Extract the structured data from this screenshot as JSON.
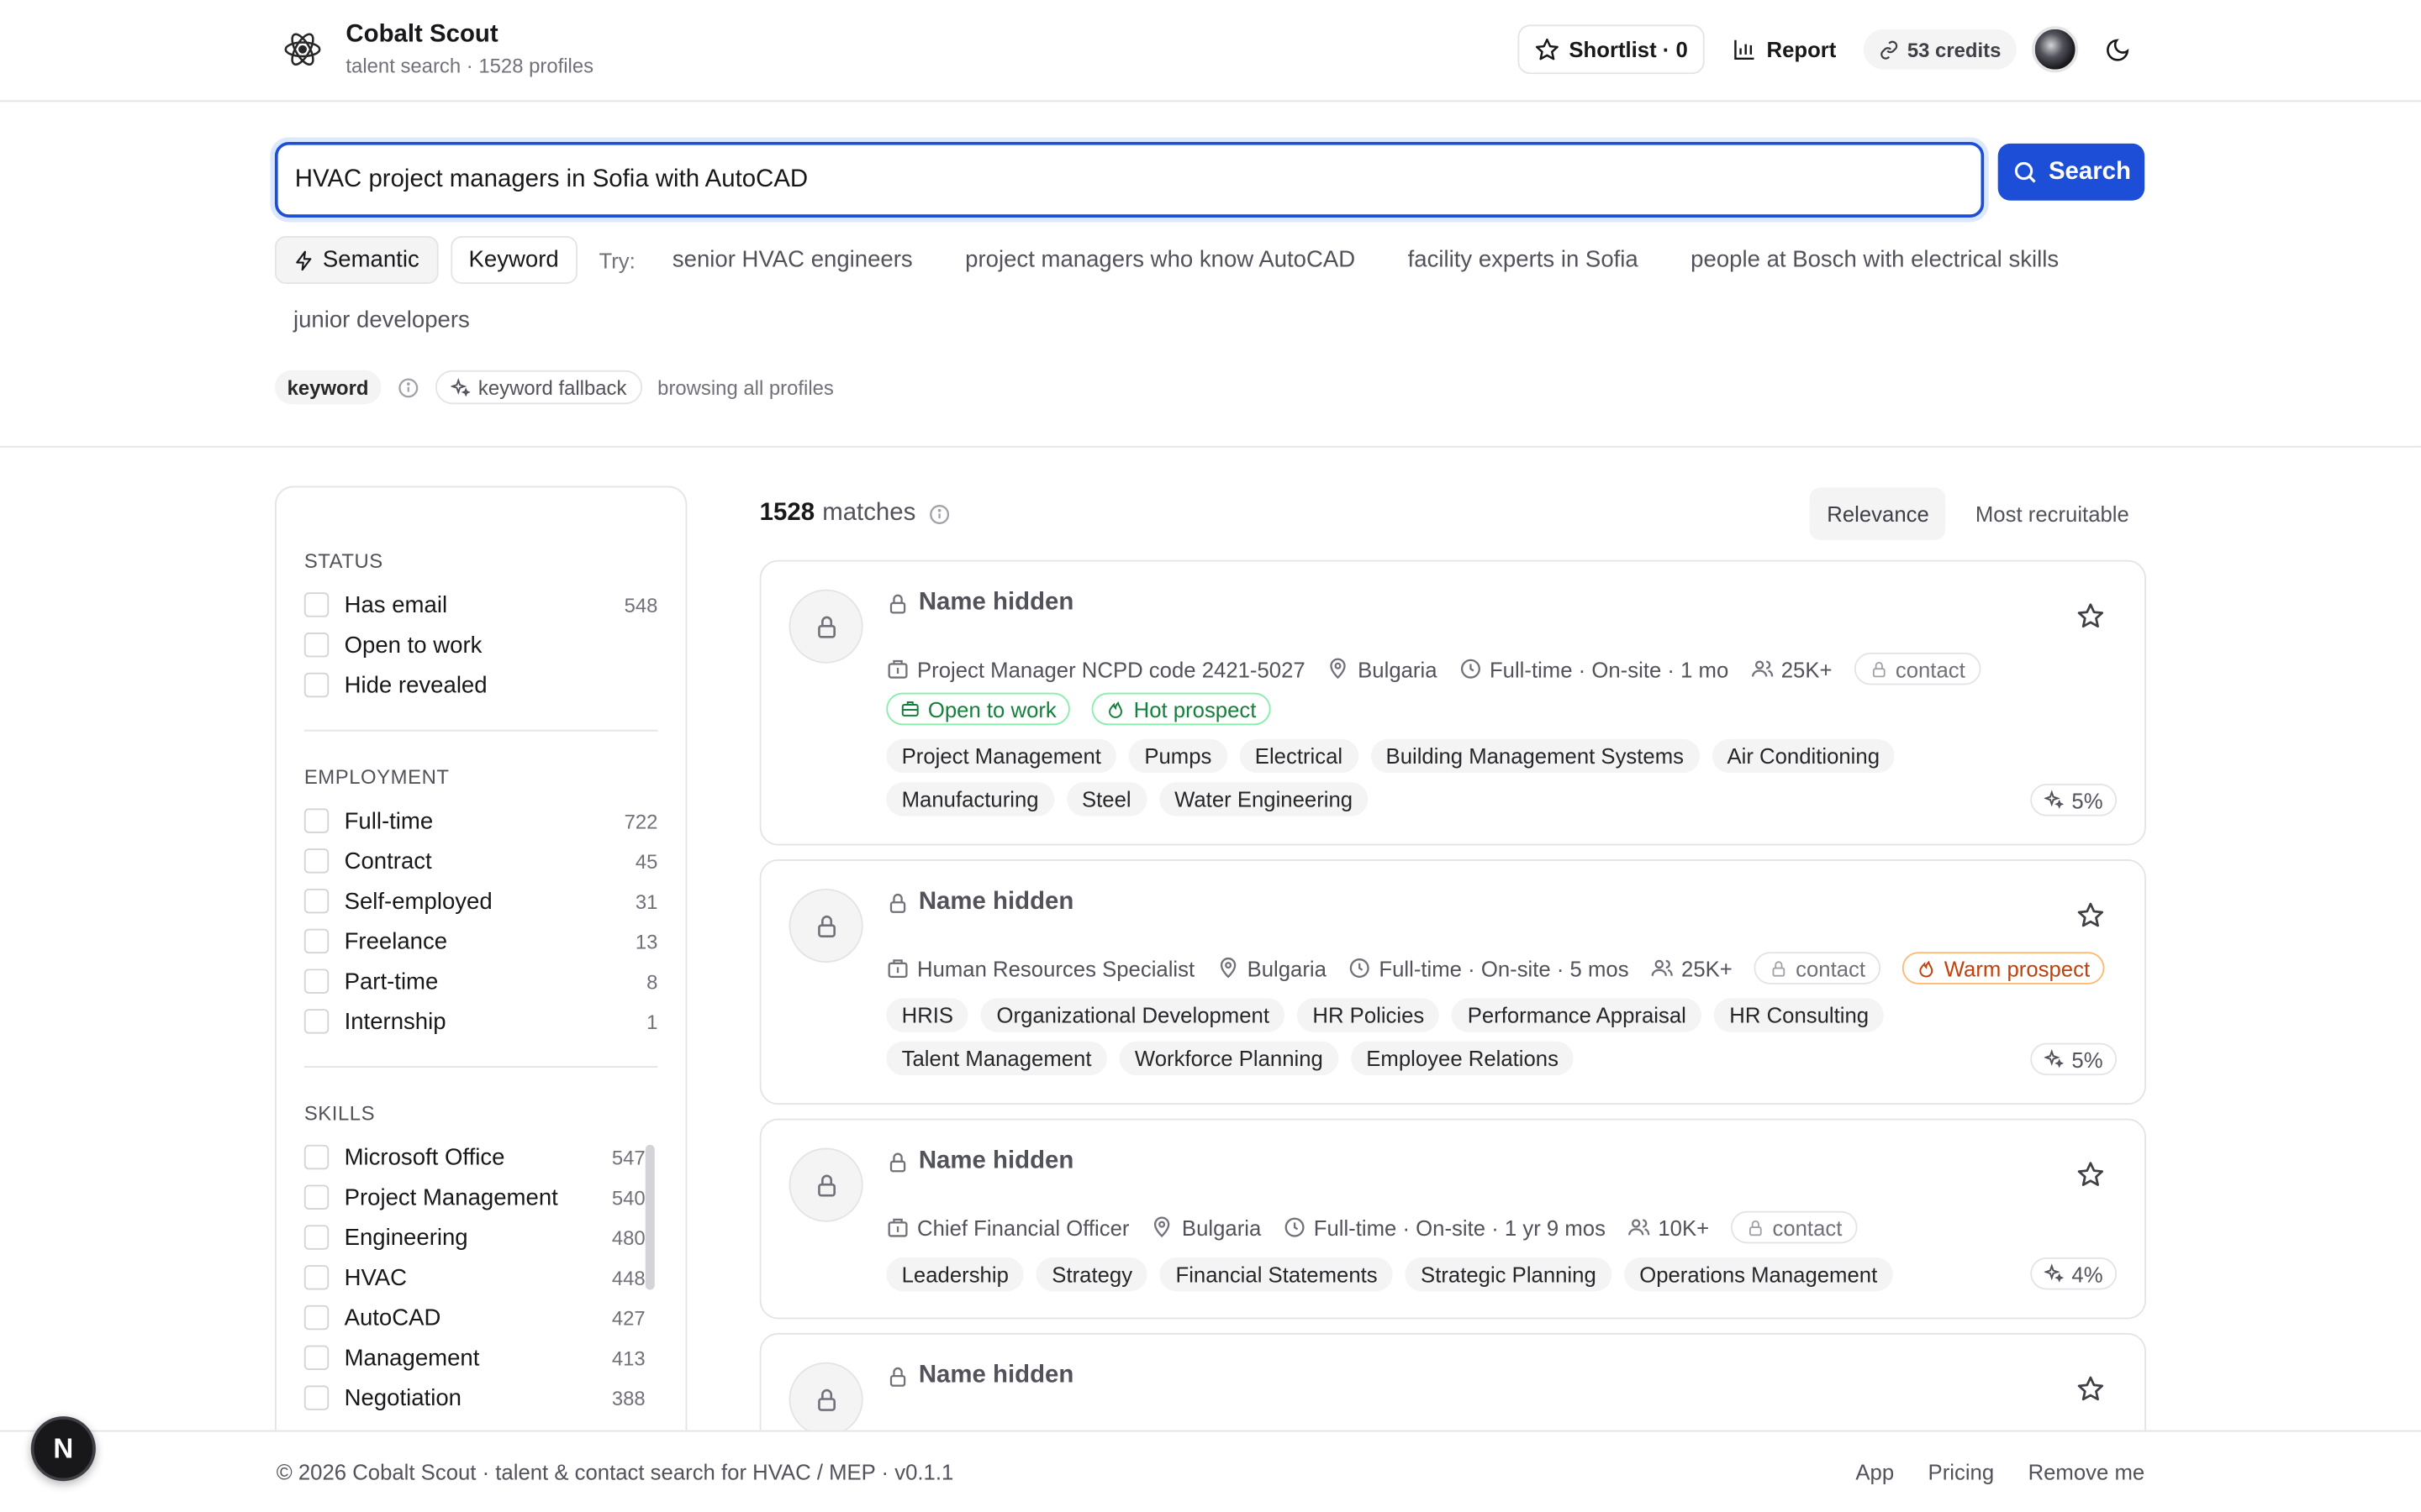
{
  "header": {
    "title": "Cobalt Scout",
    "subtitle": "talent search · 1528 profiles",
    "shortlist_label": "Shortlist · 0",
    "report_label": "Report",
    "credits_label": "53 credits"
  },
  "search": {
    "value": "HVAC project managers in Sofia with AutoCAD",
    "button_label": "Search",
    "modes": [
      "Semantic",
      "Keyword"
    ],
    "try_label": "Try:",
    "suggestions": [
      "senior HVAC engineers",
      "project managers who know AutoCAD",
      "facility experts in Sofia",
      "people at Bosch with electrical skills",
      "junior developers"
    ]
  },
  "meta": {
    "mode_pill": "keyword",
    "fallback_pill": "keyword fallback",
    "browsing": "browsing all profiles"
  },
  "filters": {
    "status": {
      "title": "STATUS",
      "items": [
        {
          "label": "Has email",
          "count": "548"
        },
        {
          "label": "Open to work",
          "count": ""
        },
        {
          "label": "Hide revealed",
          "count": ""
        }
      ]
    },
    "employment": {
      "title": "EMPLOYMENT",
      "items": [
        {
          "label": "Full-time",
          "count": "722"
        },
        {
          "label": "Contract",
          "count": "45"
        },
        {
          "label": "Self-employed",
          "count": "31"
        },
        {
          "label": "Freelance",
          "count": "13"
        },
        {
          "label": "Part-time",
          "count": "8"
        },
        {
          "label": "Internship",
          "count": "1"
        }
      ]
    },
    "skills": {
      "title": "SKILLS",
      "items": [
        {
          "label": "Microsoft Office",
          "count": "547"
        },
        {
          "label": "Project Management",
          "count": "540"
        },
        {
          "label": "Engineering",
          "count": "480"
        },
        {
          "label": "HVAC",
          "count": "448"
        },
        {
          "label": "AutoCAD",
          "count": "427"
        },
        {
          "label": "Management",
          "count": "413"
        },
        {
          "label": "Negotiation",
          "count": "388"
        }
      ]
    }
  },
  "results": {
    "count": "1528",
    "count_label": "matches",
    "sort_options": [
      "Relevance",
      "Most recruitable"
    ],
    "cards": [
      {
        "name": "Name hidden",
        "title": "Project Manager NCPD code 2421-5027",
        "location": "Bulgaria",
        "employment": "Full-time · On-site · 1 mo",
        "company_size": "25K+",
        "contact": "contact",
        "tags": [
          "Open to work",
          "Hot prospect"
        ],
        "skills": [
          "Project Management",
          "Pumps",
          "Electrical",
          "Building Management Systems",
          "Air Conditioning",
          "Manufacturing",
          "Steel",
          "Water Engineering"
        ],
        "score": "5%"
      },
      {
        "name": "Name hidden",
        "title": "Human Resources Specialist",
        "location": "Bulgaria",
        "employment": "Full-time · On-site · 5 mos",
        "company_size": "25K+",
        "contact": "contact",
        "warm": "Warm prospect",
        "skills": [
          "HRIS",
          "Organizational Development",
          "HR Policies",
          "Performance Appraisal",
          "HR Consulting",
          "Talent Management",
          "Workforce Planning",
          "Employee Relations"
        ],
        "score": "5%"
      },
      {
        "name": "Name hidden",
        "title": "Chief Financial Officer",
        "location": "Bulgaria",
        "employment": "Full-time · On-site · 1 yr 9 mos",
        "company_size": "10K+",
        "contact": "contact",
        "skills": [
          "Leadership",
          "Strategy",
          "Financial Statements",
          "Strategic Planning",
          "Operations Management"
        ],
        "score": "4%"
      },
      {
        "name": "Name hidden"
      }
    ]
  },
  "footer": {
    "copyright": "© 2026 Cobalt Scout · talent & contact search for HVAC / MEP · v0.1.1",
    "links": [
      "App",
      "Pricing",
      "Remove me"
    ]
  },
  "dev_badge": "N",
  "colors": {
    "accent": "#1d4ed8",
    "green": "#15803d",
    "warm": "#c2410c"
  }
}
